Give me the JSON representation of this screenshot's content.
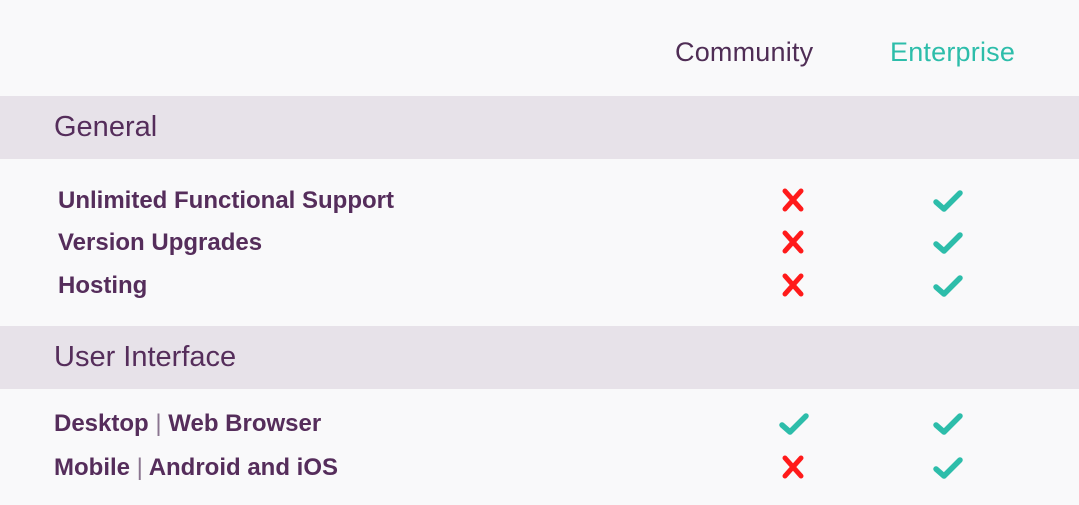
{
  "columns": {
    "community": "Community",
    "enterprise": "Enterprise"
  },
  "colors": {
    "primary_text": "#552d5b",
    "enterprise_accent": "#2dbdaa",
    "check": "#2dbdaa",
    "cross": "#ff1a1a",
    "band": "#e7e2e9",
    "background": "#f9f9fa"
  },
  "sections": [
    {
      "title": "General",
      "rows": [
        {
          "label": "Unlimited Functional Support",
          "community": "cross-icon",
          "enterprise": "check-icon"
        },
        {
          "label": "Version Upgrades",
          "community": "cross-icon",
          "enterprise": "check-icon"
        },
        {
          "label": "Hosting",
          "community": "cross-icon",
          "enterprise": "check-icon"
        }
      ]
    },
    {
      "title": "User Interface",
      "rows": [
        {
          "label_main": "Desktop",
          "label_sep": "|",
          "label_sub": "Web Browser",
          "community": "check-icon",
          "enterprise": "check-icon"
        },
        {
          "label_main": "Mobile",
          "label_sep": "|",
          "label_sub": "Android and iOS",
          "community": "cross-icon",
          "enterprise": "check-icon"
        }
      ]
    }
  ]
}
